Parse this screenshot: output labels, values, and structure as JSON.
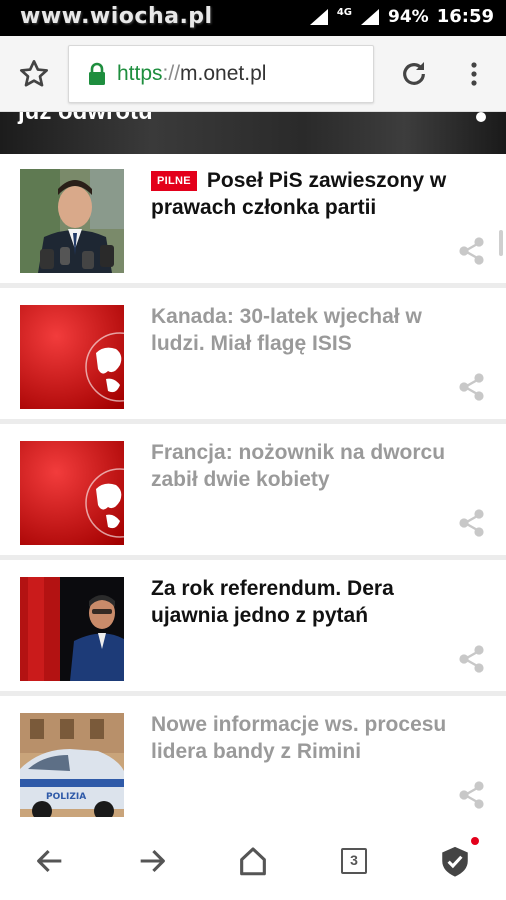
{
  "status_bar": {
    "watermark": "www.wiocha.pl",
    "network": "4G",
    "battery": "94%",
    "time": "16:59"
  },
  "browser": {
    "url_scheme": "https",
    "url_separator": "://",
    "url_host": "m.onet.pl",
    "secure_color": "#1e8e3e"
  },
  "hero": {
    "title": "już odwrotu"
  },
  "articles": [
    {
      "badge": "PILNE",
      "title": "Poseł PiS zawieszony w prawach członka partii",
      "read": false,
      "thumb": "politician-photo"
    },
    {
      "title": "Kanada: 30-latek wjechał w ludzi. Miał flagę ISIS",
      "read": true,
      "thumb": "red-globe-placeholder"
    },
    {
      "title": "Francja: nożownik na dworcu zabił dwie kobiety",
      "read": true,
      "thumb": "red-globe-placeholder"
    },
    {
      "title": "Za rok referendum. Dera ujawnia jedno z pytań",
      "read": false,
      "thumb": "speaker-photo"
    },
    {
      "title": "Nowe informacje ws. procesu lidera bandy z Rimini",
      "read": true,
      "thumb": "police-car-photo"
    }
  ],
  "bottom_nav": {
    "tab_count": "3"
  },
  "colors": {
    "badge": "#e3001b",
    "read_text": "#9a9a9a",
    "unread_text": "#111111"
  }
}
